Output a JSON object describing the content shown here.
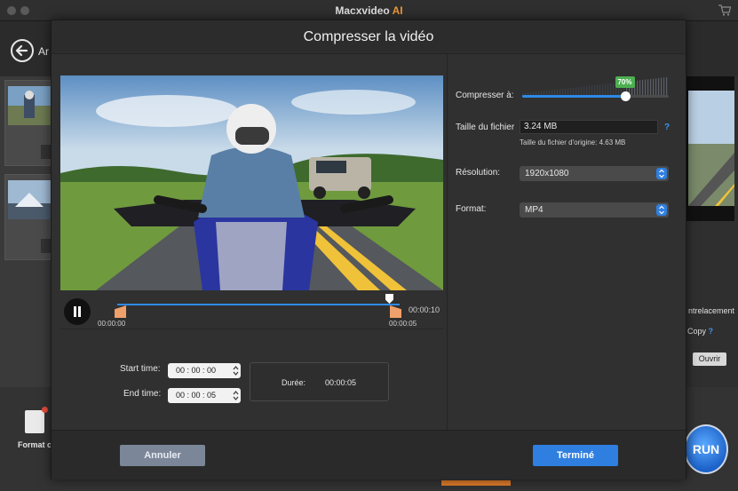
{
  "window": {
    "title_main": "Macxvideo",
    "title_accent": "AI"
  },
  "background": {
    "back_label": "Ar",
    "format_label": "Format c",
    "right_texts": {
      "interlace": "ntrelacement",
      "copy": "Copy",
      "copy_help": "?",
      "open": "Ouvrir"
    },
    "run_label": "RUN"
  },
  "modal": {
    "title": "Compresser la vidéo",
    "player": {
      "time_start": "00:00:00",
      "time_end": "00:00:05",
      "time_total": "00:00:10"
    },
    "trim": {
      "start_label": "Start time:",
      "start_value": "00 : 00 : 00",
      "end_label": "End time:",
      "end_value": "00 : 00 : 05",
      "duration_label": "Durée:",
      "duration_value": "00:00:05"
    },
    "settings": {
      "compress_label": "Compresser à:",
      "compress_percent": 70,
      "compress_badge": "70%",
      "filesize_label": "Taille du fichier",
      "filesize_value": "3.24 MB",
      "filesize_help": "?",
      "original_size": "Taille du fichier d'origine: 4.63 MB",
      "resolution_label": "Résolution:",
      "resolution_value": "1920x1080",
      "format_label": "Format:",
      "format_value": "MP4"
    },
    "footer": {
      "cancel_label": "Annuler",
      "done_label": "Terminé"
    }
  },
  "colors": {
    "accent": "#2f7fe0",
    "badge": "#4caf50",
    "trim_handle": "#f0a06a",
    "brand_ai": "#f29a3a"
  }
}
